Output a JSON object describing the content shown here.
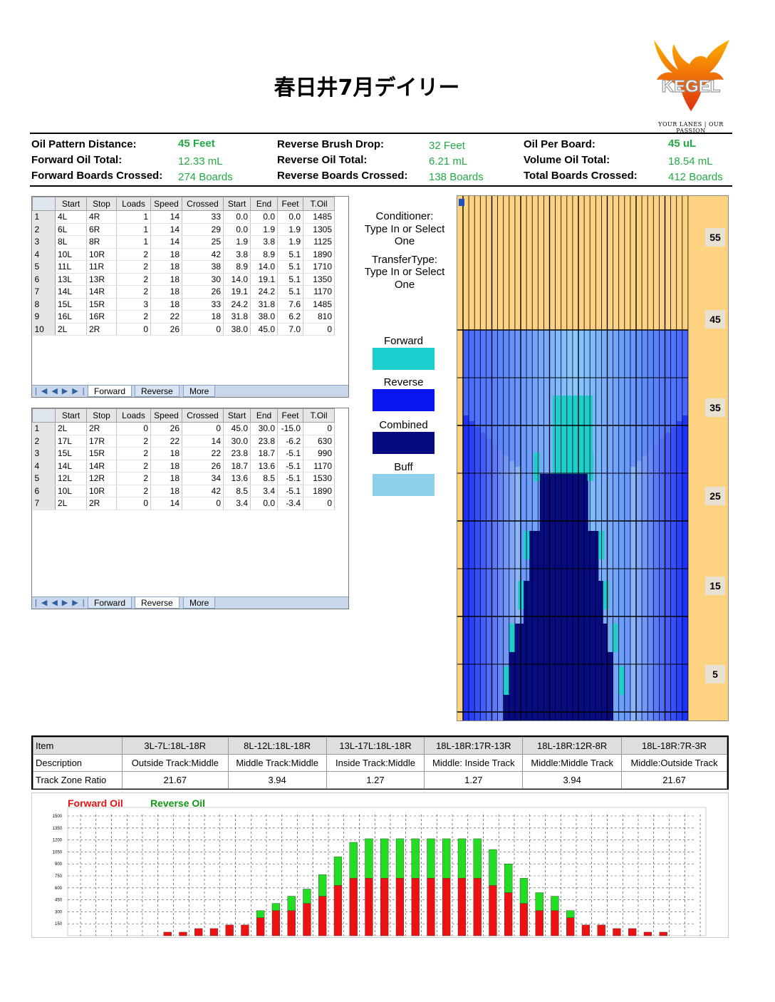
{
  "title": "春日井7月デイリー",
  "logo": {
    "brand": "KEGEL",
    "tagline": "YOUR LANES | OUR PASSION"
  },
  "summary": [
    {
      "label": "Oil Pattern Distance:",
      "value": "45 Feet",
      "bold": true
    },
    {
      "label": "Forward Oil Total:",
      "value": "12.33 mL",
      "bold": false
    },
    {
      "label": "Forward Boards Crossed:",
      "value": "274 Boards",
      "bold": false
    },
    {
      "label": "Reverse Brush Drop:",
      "value": "32 Feet",
      "bold": false
    },
    {
      "label": "Reverse Oil Total:",
      "value": "6.21 mL",
      "bold": false
    },
    {
      "label": "Reverse Boards Crossed:",
      "value": "138 Boards",
      "bold": false
    },
    {
      "label": "Oil Per Board:",
      "value": "45 uL",
      "bold": true
    },
    {
      "label": "Volume Oil Total:",
      "value": "18.54 mL",
      "bold": false
    },
    {
      "label": "Total Boards Crossed:",
      "value": "412 Boards",
      "bold": false
    }
  ],
  "columns": [
    "",
    "Start",
    "Stop",
    "Loads",
    "Speed",
    "Crossed",
    "Start",
    "End",
    "Feet",
    "T.Oil"
  ],
  "forward_table": {
    "rows": [
      [
        "1",
        "4L",
        "4R",
        "1",
        "14",
        "33",
        "0.0",
        "0.0",
        "0.0",
        "1485"
      ],
      [
        "2",
        "6L",
        "6R",
        "1",
        "14",
        "29",
        "0.0",
        "1.9",
        "1.9",
        "1305"
      ],
      [
        "3",
        "8L",
        "8R",
        "1",
        "14",
        "25",
        "1.9",
        "3.8",
        "1.9",
        "1125"
      ],
      [
        "4",
        "10L",
        "10R",
        "2",
        "18",
        "42",
        "3.8",
        "8.9",
        "5.1",
        "1890"
      ],
      [
        "5",
        "11L",
        "11R",
        "2",
        "18",
        "38",
        "8.9",
        "14.0",
        "5.1",
        "1710"
      ],
      [
        "6",
        "13L",
        "13R",
        "2",
        "18",
        "30",
        "14.0",
        "19.1",
        "5.1",
        "1350"
      ],
      [
        "7",
        "14L",
        "14R",
        "2",
        "18",
        "26",
        "19.1",
        "24.2",
        "5.1",
        "1170"
      ],
      [
        "8",
        "15L",
        "15R",
        "3",
        "18",
        "33",
        "24.2",
        "31.8",
        "7.6",
        "1485"
      ],
      [
        "9",
        "16L",
        "16R",
        "2",
        "22",
        "18",
        "31.8",
        "38.0",
        "6.2",
        "810"
      ],
      [
        "10",
        "2L",
        "2R",
        "0",
        "26",
        "0",
        "38.0",
        "45.0",
        "7.0",
        "0"
      ]
    ],
    "tabs": [
      "Forward",
      "Reverse",
      "More"
    ],
    "active_tab": 0
  },
  "reverse_table": {
    "rows": [
      [
        "1",
        "2L",
        "2R",
        "0",
        "26",
        "0",
        "45.0",
        "30.0",
        "-15.0",
        "0"
      ],
      [
        "2",
        "17L",
        "17R",
        "2",
        "22",
        "14",
        "30.0",
        "23.8",
        "-6.2",
        "630"
      ],
      [
        "3",
        "15L",
        "15R",
        "2",
        "18",
        "22",
        "23.8",
        "18.7",
        "-5.1",
        "990"
      ],
      [
        "4",
        "14L",
        "14R",
        "2",
        "18",
        "26",
        "18.7",
        "13.6",
        "-5.1",
        "1170"
      ],
      [
        "5",
        "12L",
        "12R",
        "2",
        "18",
        "34",
        "13.6",
        "8.5",
        "-5.1",
        "1530"
      ],
      [
        "6",
        "10L",
        "10R",
        "2",
        "18",
        "42",
        "8.5",
        "3.4",
        "-5.1",
        "1890"
      ],
      [
        "7",
        "2L",
        "2R",
        "0",
        "14",
        "0",
        "3.4",
        "0.0",
        "-3.4",
        "0"
      ]
    ],
    "tabs": [
      "Forward",
      "Reverse",
      "More"
    ],
    "active_tab": 1
  },
  "conditioner": {
    "line1": "Conditioner:",
    "line2": "Type In or Select",
    "line3": "One"
  },
  "transfer": {
    "line1": "TransferType:",
    "line2": "Type In or Select",
    "line3": "One"
  },
  "legend": [
    {
      "label": "Forward",
      "color": "#1ccfcf"
    },
    {
      "label": "Reverse",
      "color": "#0a14f0"
    },
    {
      "label": "Combined",
      "color": "#060b82"
    },
    {
      "label": "Buff",
      "color": "#8ed0ea"
    }
  ],
  "lane_markers": [
    "55",
    "45",
    "35",
    "25",
    "15",
    "5"
  ],
  "zone_table": {
    "header": [
      "Item",
      "3L-7L:18L-18R",
      "8L-12L:18L-18R",
      "13L-17L:18L-18R",
      "18L-18R:17R-13R",
      "18L-18R:12R-8R",
      "18L-18R:7R-3R"
    ],
    "description": [
      "Description",
      "Outside Track:Middle",
      "Middle Track:Middle",
      "Inside Track:Middle",
      "Middle: Inside Track",
      "Middle:Middle Track",
      "Middle:Outside Track"
    ],
    "ratio": [
      "Track Zone Ratio",
      "21.67",
      "3.94",
      "1.27",
      "1.27",
      "3.94",
      "21.67"
    ]
  },
  "chart_data": {
    "type": "bar",
    "stacked": true,
    "series": [
      {
        "name": "Forward Oil",
        "color": "#ee1111",
        "values": [
          0,
          0,
          0,
          0,
          0,
          45,
          45,
          90,
          90,
          135,
          135,
          225,
          315,
          315,
          405,
          495,
          630,
          720,
          720,
          720,
          720,
          720,
          720,
          720,
          720,
          720,
          630,
          540,
          405,
          315,
          315,
          225,
          135,
          135,
          90,
          90,
          45,
          45,
          0,
          0
        ]
      },
      {
        "name": "Reverse Oil",
        "color": "#22dd22",
        "values": [
          0,
          0,
          0,
          0,
          0,
          0,
          0,
          0,
          0,
          0,
          0,
          90,
          90,
          180,
          180,
          270,
          360,
          450,
          495,
          495,
          495,
          495,
          495,
          495,
          495,
          495,
          450,
          360,
          315,
          225,
          180,
          90,
          0,
          0,
          0,
          0,
          0,
          0,
          0,
          0
        ]
      }
    ],
    "y_ticks": [
      "1500",
      "1350",
      "1200",
      "1050",
      "900",
      "750",
      "600",
      "450",
      "300",
      "150"
    ],
    "ylim": [
      0,
      1500
    ],
    "grid": true,
    "legend": "top-left"
  }
}
